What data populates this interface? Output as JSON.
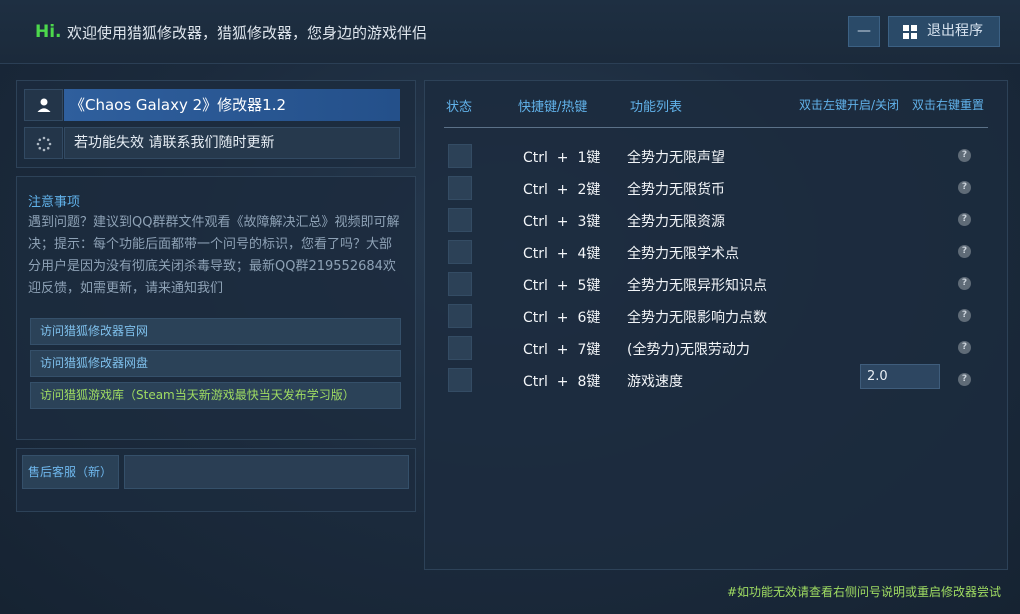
{
  "header": {
    "hi": "Hi.",
    "welcome": "欢迎使用猎狐修改器，猎狐修改器，您身边的游戏伴侣",
    "minimize_label": "—",
    "exit_label": "退出程序"
  },
  "game": {
    "title": "《Chaos Galaxy 2》修改器1.2",
    "update_notice": "若功能失效  请联系我们随时更新"
  },
  "notice": {
    "title": "注意事项",
    "body": "遇到问题？建议到QQ群群文件观看《故障解决汇总》视频即可解决；提示：每个功能后面都带一个问号的标识，您看了吗？大部分用户是因为没有彻底关闭杀毒导致；最新QQ群219552684欢迎反馈，如需更新，请来通知我们"
  },
  "links": [
    {
      "label": "访问猎狐修改器官网"
    },
    {
      "label": "访问猎狐修改器网盘"
    },
    {
      "label": "访问猎狐游戏库（Steam当天新游戏最快当天发布学习版）"
    }
  ],
  "service": {
    "label": "售后客服（新）"
  },
  "columns": {
    "status": "状态",
    "hotkey": "快捷键/热键",
    "function_list": "功能列表",
    "toggle_hint": "双击左键开启/关闭",
    "reset_hint": "双击右键重置"
  },
  "cheats": [
    {
      "hotkey": "Ctrl  +  1键",
      "name": "全势力无限声望"
    },
    {
      "hotkey": "Ctrl  +  2键",
      "name": "全势力无限货币"
    },
    {
      "hotkey": "Ctrl  +  3键",
      "name": "全势力无限资源"
    },
    {
      "hotkey": "Ctrl  +  4键",
      "name": "全势力无限学术点"
    },
    {
      "hotkey": "Ctrl  +  5键",
      "name": "全势力无限异形知识点"
    },
    {
      "hotkey": "Ctrl  +  6键",
      "name": "全势力无限影响力点数"
    },
    {
      "hotkey": "Ctrl  +  7键",
      "name": "(全势力)无限劳动力"
    },
    {
      "hotkey": "Ctrl  +  8键",
      "name": "游戏速度",
      "value": "2.0"
    }
  ],
  "help_glyph": "?",
  "footer": {
    "note": "#如功能无效请查看右侧问号说明或重启修改器尝试"
  },
  "colors": {
    "accent_blue": "#61b2ea",
    "hi_green": "#4cd84c",
    "footer_green": "#9fdc62",
    "title_blue": "#2f5f9d"
  }
}
